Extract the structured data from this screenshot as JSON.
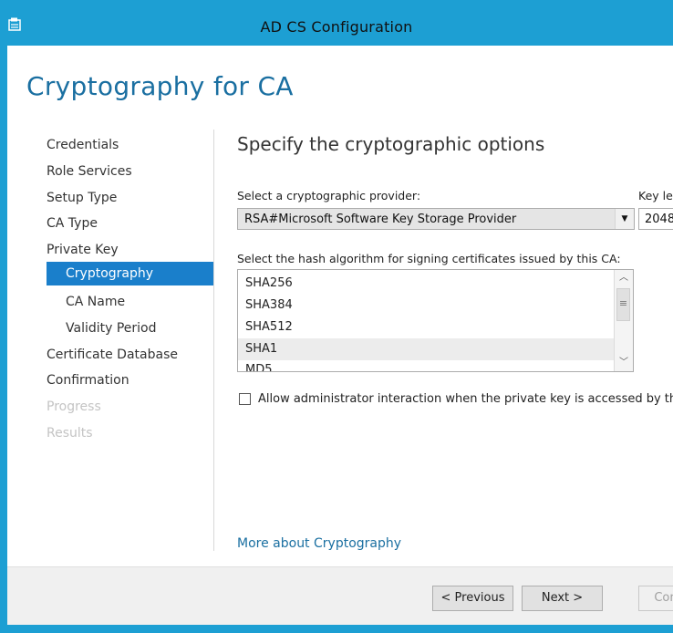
{
  "window": {
    "title": "AD CS Configuration"
  },
  "page": {
    "title": "Cryptography for CA"
  },
  "nav": {
    "items": [
      {
        "label": "Credentials"
      },
      {
        "label": "Role Services"
      },
      {
        "label": "Setup Type"
      },
      {
        "label": "CA Type"
      },
      {
        "label": "Private Key"
      },
      {
        "label": "Cryptography"
      },
      {
        "label": "CA Name"
      },
      {
        "label": "Validity Period"
      },
      {
        "label": "Certificate Database"
      },
      {
        "label": "Confirmation"
      },
      {
        "label": "Progress"
      },
      {
        "label": "Results"
      }
    ]
  },
  "main": {
    "section_title": "Specify the cryptographic options",
    "provider_label": "Select a cryptographic provider:",
    "provider_value": "RSA#Microsoft Software Key Storage Provider",
    "key_length_label": "Key le",
    "key_length_value": "2048",
    "hash_label": "Select the hash algorithm for signing certificates issued by this CA:",
    "hash_options": [
      "SHA256",
      "SHA384",
      "SHA512",
      "SHA1",
      "MD5"
    ],
    "checkbox_label": "Allow administrator interaction when the private key is accessed by the C",
    "more_link": "More about Cryptography"
  },
  "footer": {
    "previous": "< Previous",
    "next": "Next >",
    "configure": "Con"
  },
  "colors": {
    "accent": "#1d9fd3",
    "title_blue": "#1a6fa1",
    "selection": "#1a7fcb"
  }
}
